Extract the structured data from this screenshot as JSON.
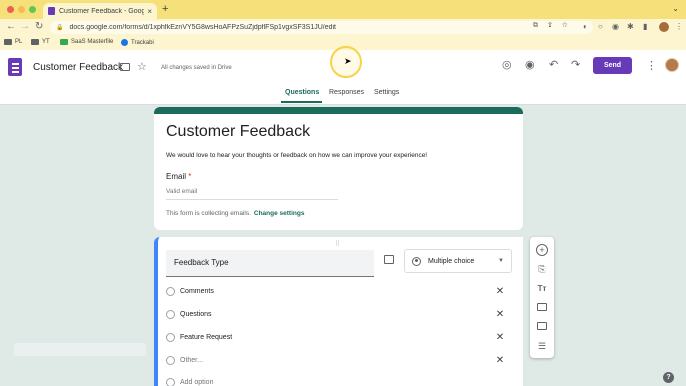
{
  "browser": {
    "tab_title": "Customer Feedback - Google",
    "tab_close": "×",
    "new_tab": "+",
    "url": "docs.google.com/forms/d/1xphfkEznVY5G8wsHoAFPzSuZjdpflFSp1vgxSF3S1JU/edit",
    "bookmarks": [
      "PL",
      "YT",
      "SaaS Masterfile",
      "Trackabi"
    ]
  },
  "header": {
    "title": "Customer Feedback",
    "saved_status": "All changes saved in Drive",
    "send_label": "Send"
  },
  "tabs": [
    {
      "label": "Questions",
      "active": true
    },
    {
      "label": "Responses",
      "active": false
    },
    {
      "label": "Settings",
      "active": false
    }
  ],
  "form": {
    "title": "Customer Feedback",
    "description": "We would love to hear your thoughts or feedback on how we can improve your experience!",
    "email_label": "Email",
    "email_required_mark": "*",
    "email_placeholder": "Valid email",
    "collecting_text": "This form is collecting emails.",
    "change_settings": "Change settings"
  },
  "question": {
    "title": "Feedback Type",
    "type": "Multiple choice",
    "options": [
      "Comments",
      "Questions",
      "Feature Request"
    ],
    "other_label": "Other...",
    "add_option": "Add option"
  },
  "colors": {
    "accent": "#1b6b5a",
    "brand": "#673ab7",
    "background": "#dfe9e6"
  }
}
